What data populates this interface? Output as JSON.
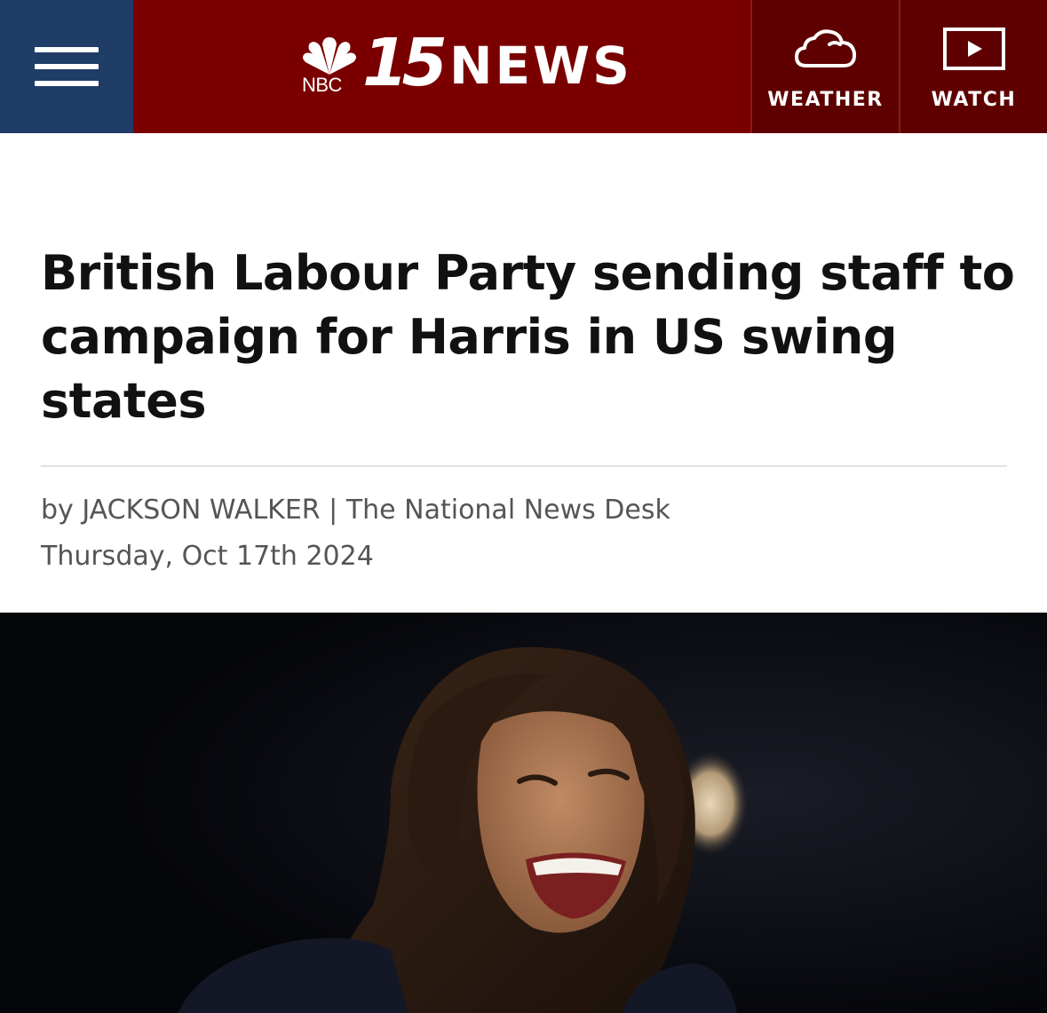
{
  "header": {
    "logo_network": "NBC",
    "logo_channel": "15",
    "logo_news": "NEWS",
    "weather_label": "WEATHER",
    "watch_label": "WATCH"
  },
  "article": {
    "headline": "British Labour Party sending staff to campaign for Harris in US swing states",
    "byline": "by JACKSON WALKER | The National News Desk",
    "date": "Thursday, Oct 17th 2024"
  },
  "colors": {
    "menu_bg": "#1f3d66",
    "brand_bg": "#7a0000",
    "nav_bg": "#5e0000"
  },
  "icons": {
    "menu": "hamburger-icon",
    "weather": "cloud-icon",
    "watch": "play-icon",
    "logo": "peacock-icon"
  }
}
